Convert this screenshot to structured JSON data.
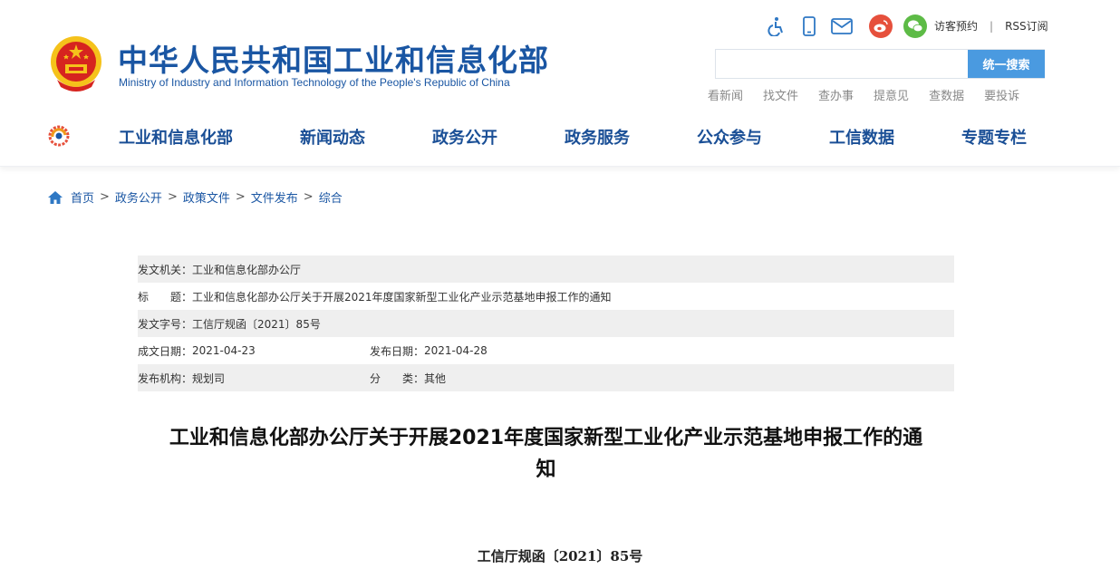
{
  "header": {
    "title": "中华人民共和国工业和信息化部",
    "subtitle": "Ministry of Industry and Information Technology of the People's Republic of China",
    "top_links": {
      "visitor": "访客预约",
      "separator": "|",
      "rss": "RSS订阅"
    },
    "icons": [
      "accessibility-icon",
      "mobile-icon",
      "mail-icon",
      "weibo-icon",
      "wechat-icon"
    ],
    "search": {
      "placeholder": "",
      "button_label": "统一搜索"
    },
    "quick_links": [
      "看新闻",
      "找文件",
      "查办事",
      "提意见",
      "查数据",
      "要投诉"
    ]
  },
  "nav": {
    "items": [
      "工业和信息化部",
      "新闻动态",
      "政务公开",
      "政务服务",
      "公众参与",
      "工信数据",
      "专题专栏"
    ]
  },
  "breadcrumb": {
    "items": [
      "首页",
      "政务公开",
      "政策文件",
      "文件发布",
      "综合"
    ],
    "separator": ">"
  },
  "meta": {
    "issuer_label": "发文机关：",
    "issuer": "工业和信息化部办公厅",
    "title_label": "标　　题：",
    "title": "工业和信息化部办公厅关于开展2021年度国家新型工业化产业示范基地申报工作的通知",
    "docno_label": "发文字号：",
    "docno": "工信厅规函〔2021〕85号",
    "created_label": "成文日期：",
    "created": "2021-04-23",
    "published_label": "发布日期：",
    "published": "2021-04-28",
    "org_label": "发布机构：",
    "org": "规划司",
    "category_label": "分　　类：",
    "category": "其他"
  },
  "article": {
    "title_line1": "工业和信息化部办公厅关于开展2021年度国家新型工业化产业示范基地申报工作的通",
    "title_line2": "知",
    "doc_number": "工信厅规函〔2021〕85号"
  },
  "colors": {
    "brand_blue": "#1a56a3",
    "nav_blue": "#1a4f96",
    "search_button": "#4a9ae0",
    "weibo_red": "#e6503c",
    "wechat_green": "#5dbb46",
    "emblem_red": "#d6241f",
    "emblem_gold": "#f5c21b"
  }
}
